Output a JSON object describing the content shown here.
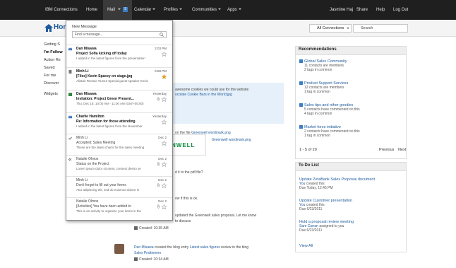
{
  "nav": {
    "brand": "IBM Connections",
    "home": "Home",
    "mail": "Mail",
    "mail_count": "5",
    "calendar": "Calendar",
    "profiles": "Profiles",
    "communities": "Communities",
    "apps": "Apps",
    "user": "Jasmine Haj",
    "share": "Share",
    "help": "Help",
    "logout": "Log Out"
  },
  "subbar": {
    "title": "Home",
    "scope": "All Connections",
    "search_placeholder": "Search"
  },
  "leftnav": [
    "Getting S",
    "I'm Follow",
    "Action Re",
    "Saved",
    "For me",
    "Discover",
    "Widgets"
  ],
  "mail_dropdown": {
    "heading": "New Message",
    "find_placeholder": "Find a message...",
    "messages": [
      {
        "from": "Dan Misawa",
        "subject": "Project Sofia kicking off today",
        "preview": "I added in the latest figures from the presentation",
        "time": "2:03 PM",
        "unread": true,
        "icon": "mail-icon",
        "starred": false,
        "attachment": false
      },
      {
        "from": "Minh Li",
        "subject": "[Files] Kevin Spacey on stage.jpg",
        "preview": "Alistair Renwie #LS12 Special guest speaker Kevin",
        "time": "5:58 PM",
        "unread": true,
        "icon": "file-icon",
        "starred": true,
        "attachment": false
      },
      {
        "from": "Dan Misawa",
        "subject": "Invitation: Project Green Present...",
        "preview": "Thu, Dec 16, 10:00 AM - 11:00 AM (GMT-05:00)",
        "time": "Yesterday",
        "unread": true,
        "icon": "calendar-icon",
        "starred": false,
        "attachment": true
      },
      {
        "from": "Charlie Hamilton",
        "subject": "Re: Information for those attending",
        "preview": "I added in the latest figures from the November",
        "time": "Yesterday",
        "unread": true,
        "icon": "mail-icon",
        "starred": false,
        "attachment": false
      },
      {
        "from": "Minh Li",
        "subject": "Accepted: Sales Meeting",
        "preview": "These are the latest charts for the sales meeting",
        "time": "Dec 2",
        "unread": false,
        "icon": "check-icon",
        "starred": false,
        "attachment": false
      },
      {
        "from": "Natalie Olmos",
        "subject": "Status on the Project",
        "preview": "Lorem ipsum dolor sit amet, consect desiro se",
        "time": "Dec 2",
        "unread": false,
        "icon": "reply-icon",
        "starred": false,
        "attachment": true
      },
      {
        "from": "Minh Li",
        "subject": "Don't forget to fill out your forms",
        "preview": "Atur adipiscing elit, sed do euismod dolore in",
        "time": "Dec 2",
        "unread": false,
        "icon": "none",
        "starred": false,
        "attachment": true
      },
      {
        "from": "Natalie Olmos",
        "subject": "[Activities] You have been added to",
        "preview": "This is an activity to organize your items in the",
        "time": "Dec 2",
        "unread": false,
        "icon": "none",
        "starred": false,
        "attachment": true
      }
    ]
  },
  "feed": {
    "line1": "awesome cookies we could use for the website",
    "line1_link": "ocolate Cookie Bars in the World.jpg",
    "line2": "on the file",
    "line2_link": "Greenwell wordmark.png",
    "line2b_link": "Greenwell wordmark.png",
    "wordmark": "NWELL",
    "line3": "d it to the pdf file?",
    "line4": "ow if this is ok.",
    "line5": "updated the Greenwell sales proposal.  Let me know",
    "line5b": "to discuss",
    "created1": "Created: 10:35 AM",
    "post_author": "Dan Misawa",
    "post_action": "created the blog entry",
    "post_link": "Latest sales figures",
    "post_tail": "review in the blog",
    "post_blog": "Sales Prattioners",
    "created2": "Created: 10:34 AM"
  },
  "recommendations": {
    "title": "Recommendations",
    "items": [
      {
        "title": "Global Sales Community",
        "l1": "11 contacts are members",
        "l2": "2 tags in common"
      },
      {
        "title": "Product Support Services",
        "l1": "12 contacts are members",
        "l2": "1 tag in common"
      },
      {
        "title": "Sales tips and other goodies",
        "l1": "5 contacts have commented on this",
        "l2": "4 tags in common"
      },
      {
        "title": "Market force initiative",
        "l1": "2 contacts have commented on this",
        "l2": "1 tag in common"
      }
    ],
    "pager": "1 - 5 of 20",
    "previous": "Previous",
    "next": "Next"
  },
  "todo": {
    "title": "To Do List",
    "items": [
      {
        "title": "Update ZetaBank Sales Proposal document",
        "who": "You",
        "l1": "created this",
        "due": "Due Today, 12:45 PM"
      },
      {
        "title": "Update Customer presentation",
        "who": "You",
        "l1": "created this",
        "due": "Due 6/23/2011"
      },
      {
        "title": "Hold a proposal review meeting",
        "who": "Sam Curran",
        "l1": "assigned to you",
        "due": "Due 6/23/2011"
      }
    ],
    "view_all": "View All"
  },
  "colors": {
    "nav_bg": "#1f1f1f",
    "link": "#1e5a9c",
    "badge": "#3b7dc4",
    "star": "#e8a317"
  }
}
